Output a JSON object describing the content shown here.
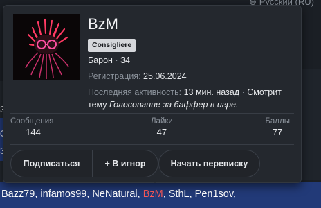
{
  "background": {
    "language_label": "Русский (RU)",
    "left_fragments": [
      "З",
      "О",
      "З"
    ],
    "footer_users_before": "Bazz79, infamos99, NeNatural, ",
    "footer_user_highlight": "BzM",
    "footer_users_after": ", SthL, Pen1sov,",
    "footer_line2": "...",
    "highlight_color": "#ff5a5a",
    "footer_color": "#223a78"
  },
  "profile": {
    "username": "BzM",
    "role": "Consigliere",
    "title": "Барон",
    "level": "34",
    "reg_label": "Регистрация:",
    "reg_date": "25.06.2024",
    "activity_label": "Последняя активность:",
    "activity_time": "13 мин. назад",
    "activity_sep": "·",
    "activity_action": "Смотрит тему",
    "activity_thread": "Голосование за баффер в игре."
  },
  "stats": {
    "messages_label": "Сообщения",
    "messages_value": "144",
    "likes_label": "Лайки",
    "likes_value": "47",
    "points_label": "Баллы",
    "points_value": "77"
  },
  "actions": {
    "subscribe": "Подписаться",
    "ignore": "+ В игнор",
    "start_conversation": "Начать переписку"
  }
}
